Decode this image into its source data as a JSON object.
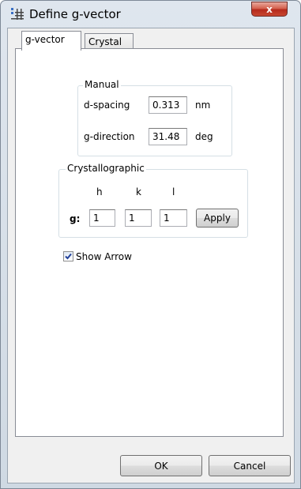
{
  "window": {
    "title": "Define g-vector",
    "close_label": "x",
    "icon": "app-grid-icon"
  },
  "tabs": [
    {
      "label": "g-vector",
      "active": true
    },
    {
      "label": "Crystal",
      "active": false
    }
  ],
  "manual": {
    "legend": "Manual",
    "d_spacing_label": "d-spacing",
    "d_spacing_value": "0.313",
    "d_spacing_unit": "nm",
    "g_direction_label": "g-direction",
    "g_direction_value": "31.48",
    "g_direction_unit": "deg"
  },
  "crystallographic": {
    "legend": "Crystallographic",
    "h_label": "h",
    "k_label": "k",
    "l_label": "l",
    "g_label": "g:",
    "h_value": "1",
    "k_value": "1",
    "l_value": "1",
    "apply_label": "Apply"
  },
  "show_arrow": {
    "label": "Show Arrow",
    "checked": true
  },
  "footer": {
    "ok_label": "OK",
    "cancel_label": "Cancel"
  }
}
